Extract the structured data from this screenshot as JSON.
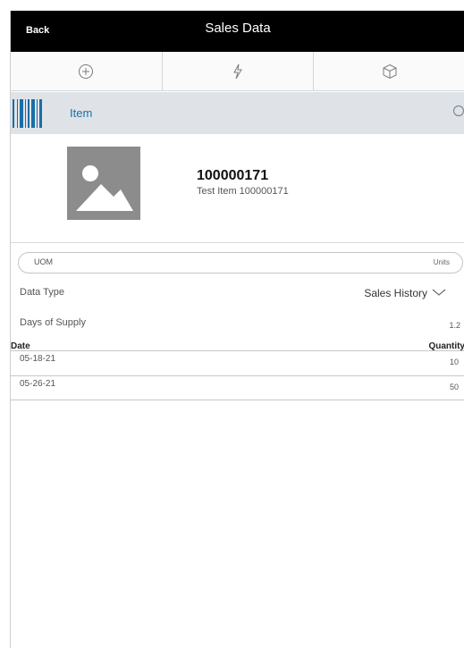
{
  "header": {
    "back_label": "Back",
    "title": "Sales Data"
  },
  "toolbar": {
    "icons": [
      "add-circle-icon",
      "lightning-icon",
      "box-icon"
    ]
  },
  "scan": {
    "label": "Item",
    "barcode_icon": "barcode-icon",
    "search_icon": "search-icon"
  },
  "item": {
    "number": "100000171",
    "description": "Test Item 100000171",
    "image_icon": "image-placeholder-icon"
  },
  "uom": {
    "label": "UOM",
    "value": "Units"
  },
  "data_type": {
    "label": "Data Type",
    "value": "Sales History"
  },
  "days_of_supply": {
    "label": "Days of Supply",
    "value": "1.2"
  },
  "table": {
    "headers": {
      "date": "Date",
      "quantity": "Quantity"
    },
    "rows": [
      {
        "date": "05-18-21",
        "quantity": "10"
      },
      {
        "date": "05-26-21",
        "quantity": "50"
      }
    ]
  },
  "colors": {
    "header_bg": "#000000",
    "accent": "#1a6ea8",
    "scanbar_bg": "#dfe3e8"
  }
}
